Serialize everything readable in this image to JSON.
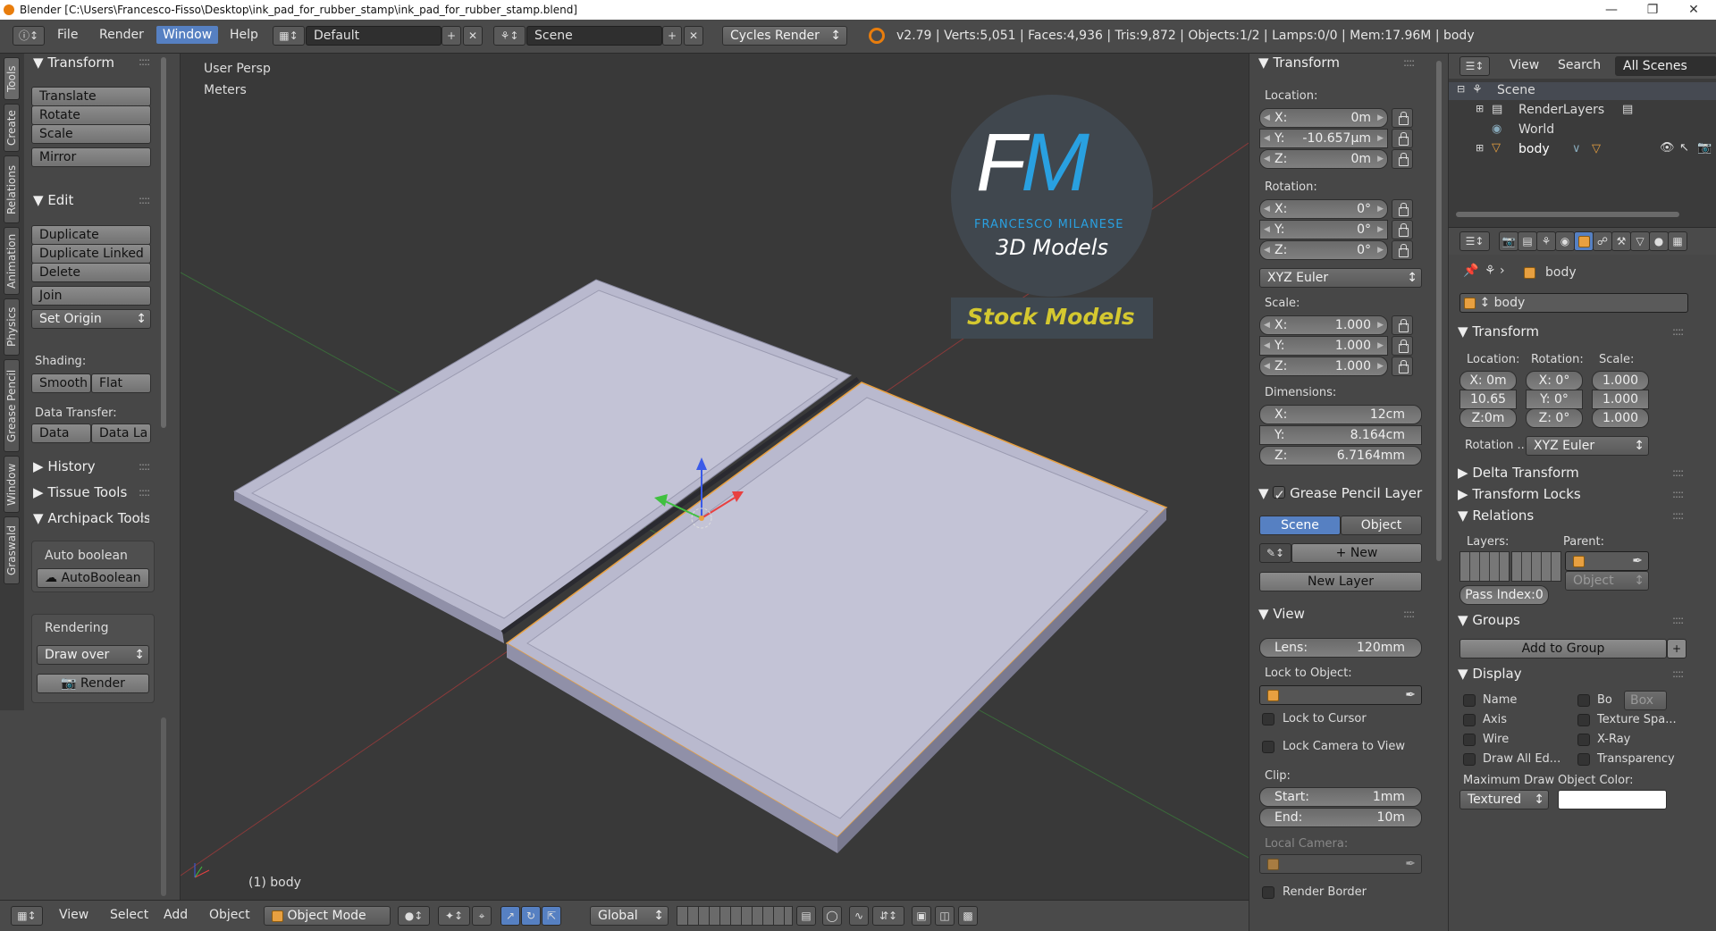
{
  "window": {
    "title": "Blender [C:\\Users\\Francesco-Fisso\\Desktop\\ink_pad_for_rubber_stamp\\ink_pad_for_rubber_stamp.blend]"
  },
  "topbar": {
    "menus": [
      "File",
      "Render",
      "Window",
      "Help"
    ],
    "layout": "Default",
    "scene": "Scene",
    "engine": "Cycles Render",
    "stats": "v2.79 | Verts:5,051 | Faces:4,936 | Tris:9,872 | Objects:1/2 | Lamps:0/0 | Mem:17.96M | body"
  },
  "tool_tabs": [
    "Tools",
    "Create",
    "Relations",
    "Animation",
    "Physics",
    "Grease Pencil",
    "Window",
    "Graswald"
  ],
  "toolshelf": {
    "transform": {
      "header": "Transform",
      "buttons": [
        "Translate",
        "Rotate",
        "Scale",
        "Mirror"
      ]
    },
    "edit": {
      "header": "Edit",
      "buttons": [
        "Duplicate",
        "Duplicate Linked",
        "Delete",
        "Join",
        "Set Origin"
      ]
    },
    "shading": {
      "label": "Shading:",
      "smooth": "Smooth",
      "flat": "Flat"
    },
    "data_transfer": {
      "label": "Data Transfer:",
      "data": "Data",
      "data_layout": "Data La"
    },
    "history": "History",
    "tissue": "Tissue Tools",
    "archipack": {
      "header": "Archipack Tools",
      "auto_boolean_label": "Auto boolean",
      "auto_boolean_btn": "AutoBoolean",
      "rendering_label": "Rendering",
      "draw_mode": "Draw over",
      "render_btn": "Render"
    }
  },
  "viewport": {
    "persp": "User Persp",
    "units": "Meters",
    "object_label": "(1) body",
    "logo": {
      "initials": "FM",
      "name": "FRANCESCO MILANESE",
      "sub": "3D Models",
      "stock": "Stock Models"
    }
  },
  "viewport_header": {
    "menus": [
      "View",
      "Select",
      "Add",
      "Object"
    ],
    "mode": "Object Mode",
    "orientation": "Global"
  },
  "nprops": {
    "transform_header": "Transform",
    "location_label": "Location:",
    "location": {
      "x": "0m",
      "y": "-10.657µm",
      "z": "0m"
    },
    "rotation_label": "Rotation:",
    "rotation": {
      "x": "0°",
      "y": "0°",
      "z": "0°"
    },
    "rotation_mode": "XYZ Euler",
    "scale_label": "Scale:",
    "scale": {
      "x": "1.000",
      "y": "1.000",
      "z": "1.000"
    },
    "dimensions_label": "Dimensions:",
    "dimensions": {
      "x": "12cm",
      "y": "8.164cm",
      "z": "6.7164mm"
    },
    "gp_header": "Grease Pencil Layer",
    "gp_scene": "Scene",
    "gp_object": "Object",
    "gp_new": "New",
    "gp_new_layer": "New Layer",
    "view_header": "View",
    "lens_label": "Lens:",
    "lens": "120mm",
    "lock_object_label": "Lock to Object:",
    "lock_cursor": "Lock to Cursor",
    "lock_camera": "Lock Camera to View",
    "clip_label": "Clip:",
    "clip_start_label": "Start:",
    "clip_start": "1mm",
    "clip_end_label": "End:",
    "clip_end": "10m",
    "local_camera": "Local Camera:",
    "render_border": "Render Border"
  },
  "outliner": {
    "menus": [
      "View",
      "Search"
    ],
    "filter": "All Scenes",
    "tree": [
      "Scene",
      "RenderLayers",
      "World",
      "body"
    ]
  },
  "properties": {
    "object_name": "body",
    "transform_header": "Transform",
    "location_label": "Location:",
    "rotation_label": "Rotation:",
    "scale_label": "Scale:",
    "loc": {
      "x": "X: 0m",
      "y": "10.65",
      "z": "Z:0m"
    },
    "rot": {
      "x": "X: 0°",
      "y": "Y: 0°",
      "z": "Z: 0°"
    },
    "scl": {
      "x": "1.000",
      "y": "1.000",
      "z": "1.000"
    },
    "rotation_mode_label": "Rotation ...",
    "rotation_mode": "XYZ Euler",
    "delta": "Delta Transform",
    "locks": "Transform Locks",
    "relations": "Relations",
    "layers_label": "Layers:",
    "parent_label": "Parent:",
    "parent_type": "Object",
    "pass_index": "Pass Index:0",
    "groups": "Groups",
    "add_group": "Add to Group",
    "display": "Display",
    "disp_name": "Name",
    "disp_bo": "Bo",
    "disp_box": "Box",
    "disp_axis": "Axis",
    "disp_texspace": "Texture Spa...",
    "disp_wire": "Wire",
    "disp_xray": "X-Ray",
    "disp_drawall": "Draw All Ed...",
    "disp_transp": "Transparency",
    "max_draw_label": "Maximum Draw",
    "obj_color_label": "Object Color:",
    "max_draw": "Textured"
  },
  "colors": {
    "accent": "#5680c2",
    "selection": "#e8a040",
    "mesh": "#b8b8cc",
    "logo_blue": "#29a0e0",
    "logo_yellow": "#d4c830"
  }
}
